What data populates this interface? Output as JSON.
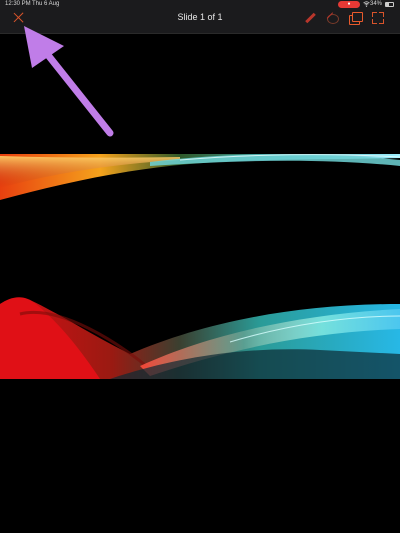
{
  "status_bar": {
    "time": "12:30 PM",
    "date": "Thu 6 Aug",
    "record_indicator": "●",
    "battery_percent": "34%"
  },
  "toolbar": {
    "title": "Slide 1 of 1",
    "icons": [
      "close-icon",
      "pencil-icon",
      "shape-icon",
      "layers-icon",
      "fullscreen-icon"
    ],
    "accent_color": "#d9542b"
  },
  "annotation": {
    "arrow_color": "#c07de8"
  }
}
